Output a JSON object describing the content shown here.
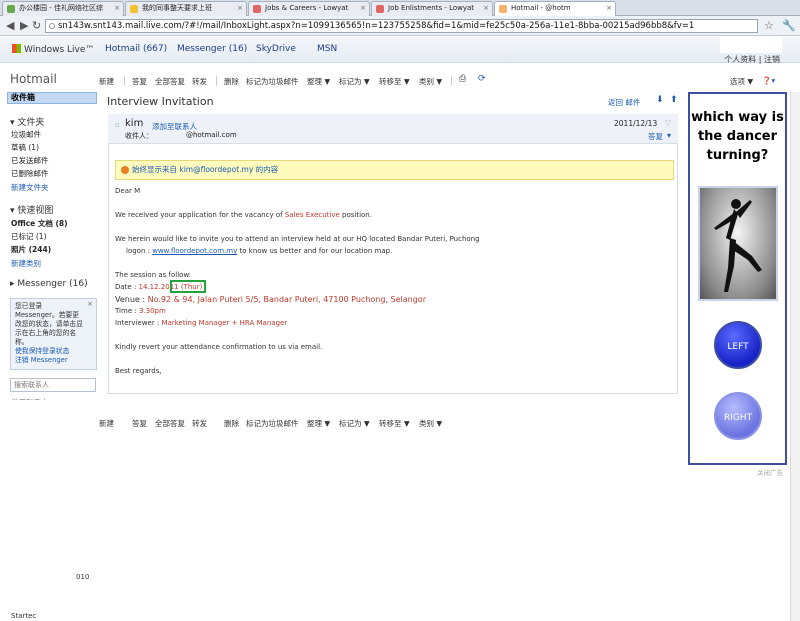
{
  "browser": {
    "tabs": [
      {
        "label": "办公楼园 - 佳礼网络社区综"
      },
      {
        "label": "我的同事整天要求上班"
      },
      {
        "label": "Jobs & Careers - Lowyat"
      },
      {
        "label": "Job Enlistments - Lowyat"
      },
      {
        "label": "Hotmail -           @hotm"
      }
    ],
    "url": "sn143w.snt143.mail.live.com/?#!/mail/InboxLight.aspx?n=1099136565!n=123755258&fid=1&mid=fe25c50a-256a-11e1-8bba-00215ad96bb8&fv=1"
  },
  "header": {
    "brand": "Windows Live™",
    "links": [
      "Hotmail (667)",
      "Messenger (16)",
      "SkyDrive",
      "MSN"
    ],
    "profile": "个人资料",
    "signout": "注销"
  },
  "toolbar": {
    "app": "Hotmail",
    "new": "新建",
    "reply": "答复",
    "reply_all": "全部答复",
    "forward": "转发",
    "delete": "删除",
    "junk": "标记为垃圾邮件",
    "sweep": "整理 ▼",
    "mark": "标记为 ▼",
    "move": "转移至 ▼",
    "category": "类别 ▼",
    "options": "选项 ▼"
  },
  "sidebar": {
    "inbox": "收件箱",
    "folders_title": "文件夹",
    "folders": [
      "垃圾邮件",
      "草稿 (1)",
      "已发送邮件",
      "已删除邮件",
      "新建文件夹"
    ],
    "quick_title": "快速视图",
    "quick": [
      "Office 文档  (8)",
      "已标记  (1)",
      "照片  (244)",
      "新建类别"
    ],
    "messenger_title": "Messenger (16)",
    "messenger_text": "您已登录 Messenger。若要更改您的状态，请单击显示在右上角的您的名称。",
    "messenger_link1": "使我保持登录状态",
    "messenger_link2": "注销 Messenger",
    "search_placeholder": "搜索联系人",
    "recent": "常用联系人",
    "footer_fragment": "Startec",
    "side_fragment": "010"
  },
  "message": {
    "title": "Interview Invitation",
    "back": "返回 邮件",
    "from_name": "kim",
    "add_contact": "添加至联系人",
    "to_label": "收件人：",
    "to_address": "@hotmail.com",
    "date": "2011/12/13",
    "reply": "答复",
    "notice": "始终显示来自 kim@floordepot.my 的内容",
    "lines": {
      "dear": "Dear M",
      "received_pre": "We received your application for the vacancy of ",
      "position": "Sales Executive",
      "received_post": " position.",
      "invite": "We herein would like to invite you to attend an interview held at our HQ located Bandar Puteri, Puchong",
      "logon_pre": "logon : ",
      "logon_link": "www.floordepot.com.my",
      "logon_post": "  to know us better and for our location map.",
      "session": "The session as follow:",
      "date_label": "Date : ",
      "date_value": "14.12.2011 (Thur)",
      "venue_label": "Venue : ",
      "venue_value": "No.92 & 94, Jalan Puteri 5/5, Bandar Puteri, 47100 Puchong, Selangor",
      "time_label": "Time : ",
      "time_value": "3.30pm",
      "interviewer_label": "Interviewer : ",
      "interviewer_value": "Marketing Manager + HRA Manager",
      "kindly": "Kindly revert your attendance confirmation to us via email.",
      "regards": "Best regards,"
    }
  },
  "ad": {
    "question": "which way is the dancer turning?",
    "left": "LEFT",
    "right": "RIGHT",
    "close": "关闭广告"
  },
  "colors": {
    "accent": "#1b5bb4",
    "highlight_box": "#27a13b",
    "ad_border": "#3e4fa3",
    "warning_bg": "#fffbbd"
  }
}
